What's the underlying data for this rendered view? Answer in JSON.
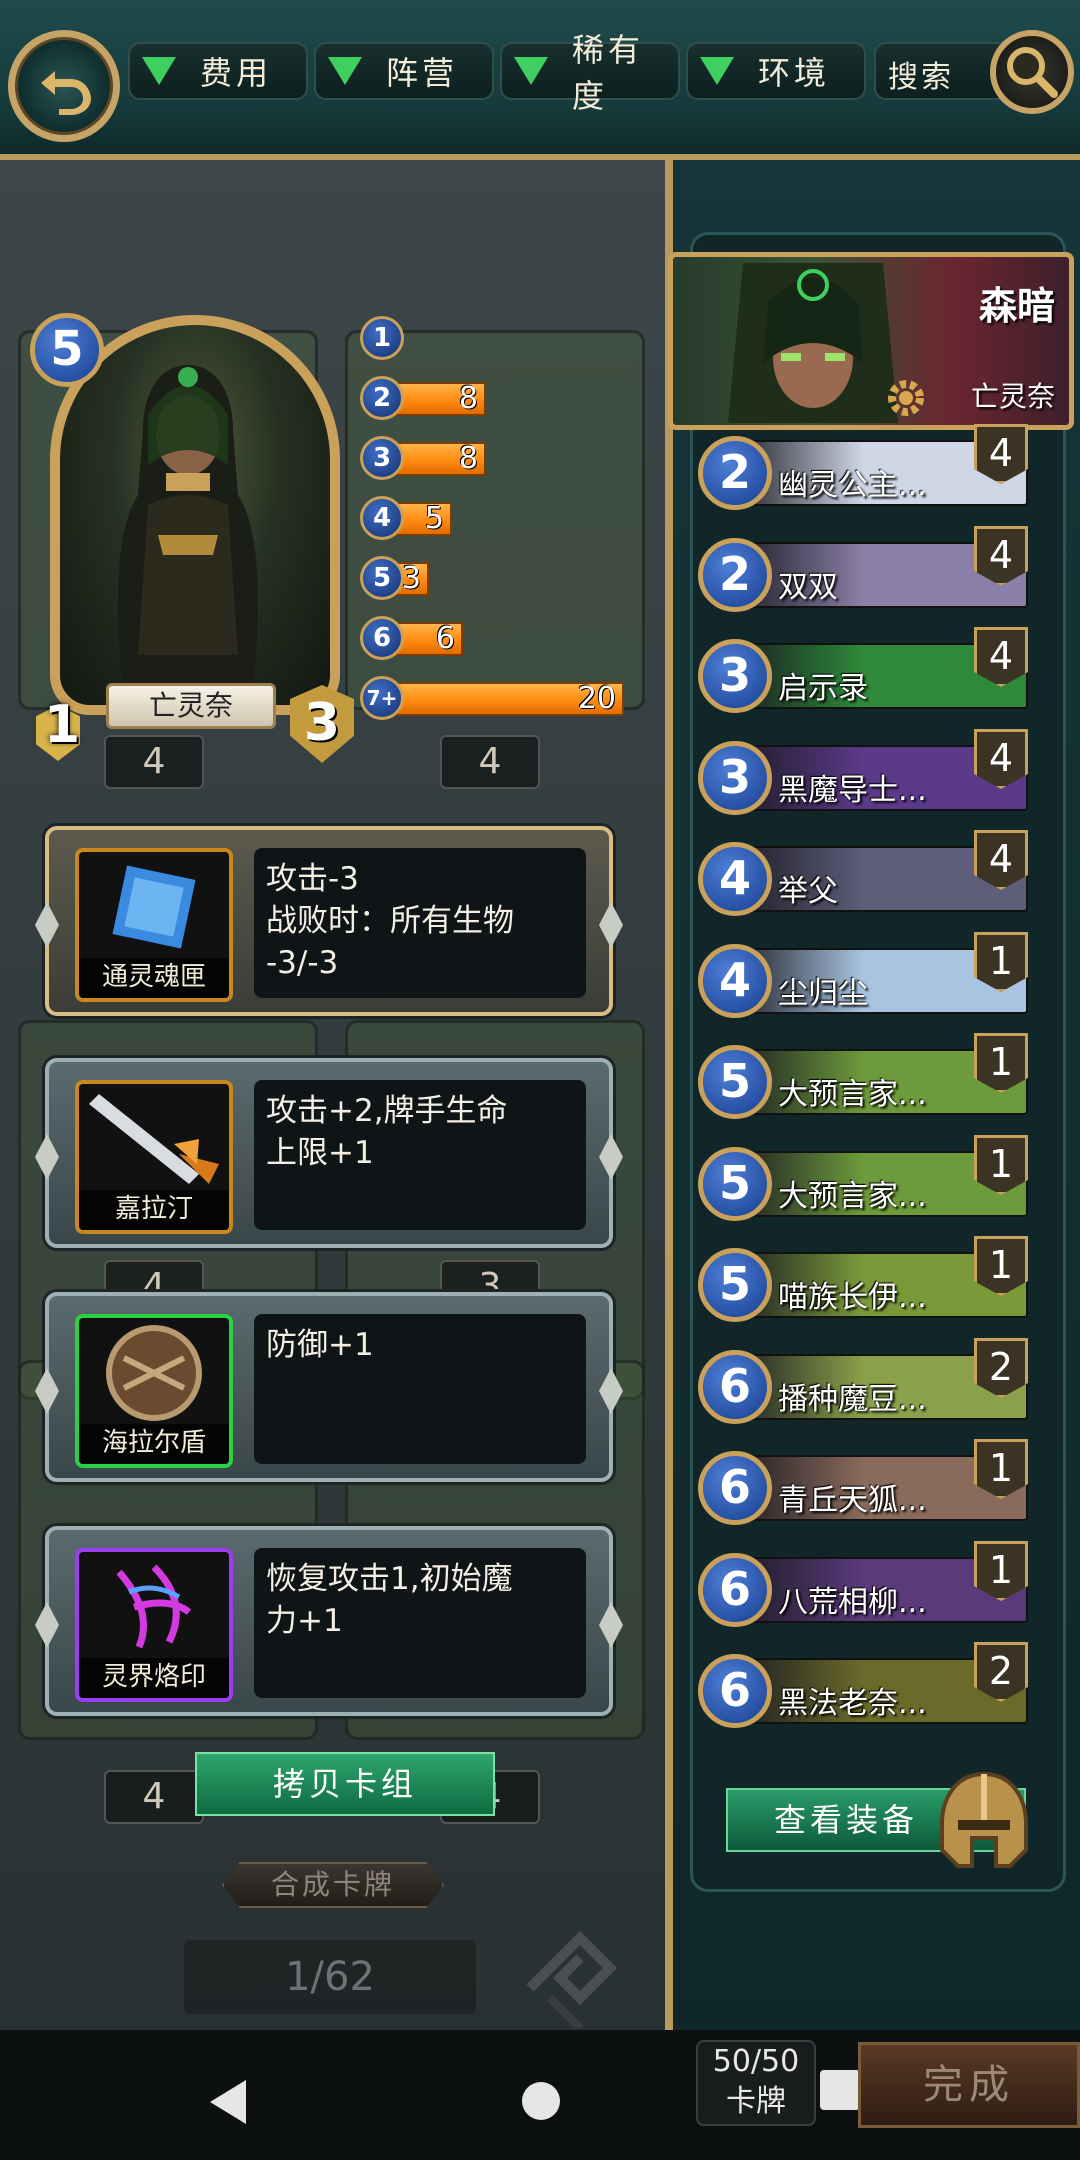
{
  "filters": [
    "费用",
    "阵营",
    "稀有度",
    "环境"
  ],
  "search_label": "搜索",
  "hero": {
    "name": "亡灵奈",
    "cost": "5",
    "attack": "1",
    "health": "3"
  },
  "cost_distribution": [
    {
      "cost": "1",
      "count": ""
    },
    {
      "cost": "2",
      "count": "8"
    },
    {
      "cost": "3",
      "count": "8"
    },
    {
      "cost": "4",
      "count": "5"
    },
    {
      "cost": "5",
      "count": "3"
    },
    {
      "cost": "6",
      "count": "6"
    },
    {
      "cost": "7+",
      "count": "20"
    }
  ],
  "cost_fill": [
    0,
    0.4,
    0.4,
    0.25,
    0.15,
    0.3,
    1.0
  ],
  "equipment": [
    {
      "name": "通灵魂匣",
      "desc": "攻击-3\n战败时：所有生物\n-3/-3",
      "frame": "gold",
      "icon_frame": "orange"
    },
    {
      "name": "嘉拉汀",
      "desc": "攻击+2,牌手生命\n上限+1",
      "frame": "silver",
      "icon_frame": "orange"
    },
    {
      "name": "海拉尔盾",
      "desc": "防御+1",
      "frame": "silver",
      "icon_frame": "green"
    },
    {
      "name": "灵界烙印",
      "desc": "恢复攻击1,初始魔\n力+1",
      "frame": "silver",
      "icon_frame": "purple"
    }
  ],
  "copy_deck_label": "拷贝卡组",
  "craft_label": "合成卡牌",
  "page_indicator": "1/62",
  "leader": {
    "name": "森暗",
    "faction": "亡灵奈"
  },
  "deck_cards": [
    {
      "cost": "2",
      "name": "幽灵公主...",
      "count": "4",
      "color": "#cfd6e6"
    },
    {
      "cost": "2",
      "name": "双双",
      "count": "4",
      "color": "#8a7fa6"
    },
    {
      "cost": "3",
      "name": "启示录",
      "count": "4",
      "color": "#2e8a3a"
    },
    {
      "cost": "3",
      "name": "黑魔导士...",
      "count": "4",
      "color": "#5b3a8a"
    },
    {
      "cost": "4",
      "name": "举父",
      "count": "4",
      "color": "#5e5d7a"
    },
    {
      "cost": "4",
      "name": "尘归尘",
      "count": "1",
      "color": "#a8c4e0"
    },
    {
      "cost": "5",
      "name": "大预言家...",
      "count": "1",
      "color": "#6d9a3a"
    },
    {
      "cost": "5",
      "name": "大预言家...",
      "count": "1",
      "color": "#6d9a3a"
    },
    {
      "cost": "5",
      "name": "喵族长伊...",
      "count": "1",
      "color": "#7a9a3a"
    },
    {
      "cost": "6",
      "name": "播种魔豆...",
      "count": "2",
      "color": "#8aa04a"
    },
    {
      "cost": "6",
      "name": "青丘天狐...",
      "count": "1",
      "color": "#8a6a5a"
    },
    {
      "cost": "6",
      "name": "八荒相柳...",
      "count": "1",
      "color": "#5a3a7a"
    },
    {
      "cost": "6",
      "name": "黑法老奈...",
      "count": "2",
      "color": "#6a6a2a"
    }
  ],
  "view_equip_label": "查看装备",
  "deck_count": {
    "value": "50/50",
    "label": "卡牌"
  },
  "done_label": "完成"
}
